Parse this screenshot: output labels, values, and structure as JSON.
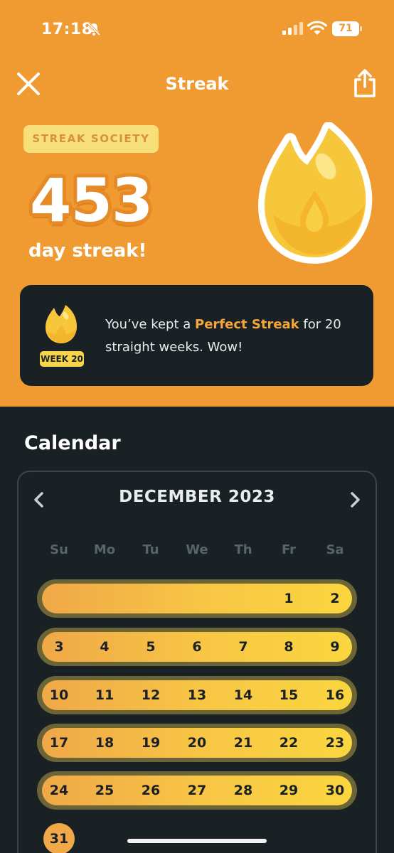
{
  "status_bar": {
    "time": "17:18",
    "battery": "71"
  },
  "header": {
    "title": "Streak",
    "close_icon": "close-icon",
    "share_icon": "share-icon"
  },
  "streak": {
    "society_badge": "STREAK SOCIETY",
    "count": "453",
    "label": "day streak!"
  },
  "perfect_card": {
    "week_badge": "WEEK 20",
    "text_before": "You’ve kept a ",
    "highlight": "Perfect Streak",
    "text_after": " for 20 straight weeks. Wow!"
  },
  "calendar": {
    "title": "Calendar",
    "month": "DECEMBER 2023",
    "days_of_week": [
      "Su",
      "Mo",
      "Tu",
      "We",
      "Th",
      "Fr",
      "Sa"
    ],
    "weeks": [
      [
        "",
        "",
        "",
        "",
        "",
        "1",
        "2"
      ],
      [
        "3",
        "4",
        "5",
        "6",
        "7",
        "8",
        "9"
      ],
      [
        "10",
        "11",
        "12",
        "13",
        "14",
        "15",
        "16"
      ],
      [
        "17",
        "18",
        "19",
        "20",
        "21",
        "22",
        "23"
      ],
      [
        "24",
        "25",
        "26",
        "27",
        "28",
        "29",
        "30"
      ],
      [
        "31",
        "",
        "",
        "",
        "",
        "",
        ""
      ]
    ]
  },
  "colors": {
    "accent_orange": "#f09a32",
    "dark_bg": "#1a2125",
    "streak_yellow": "#fad640"
  }
}
